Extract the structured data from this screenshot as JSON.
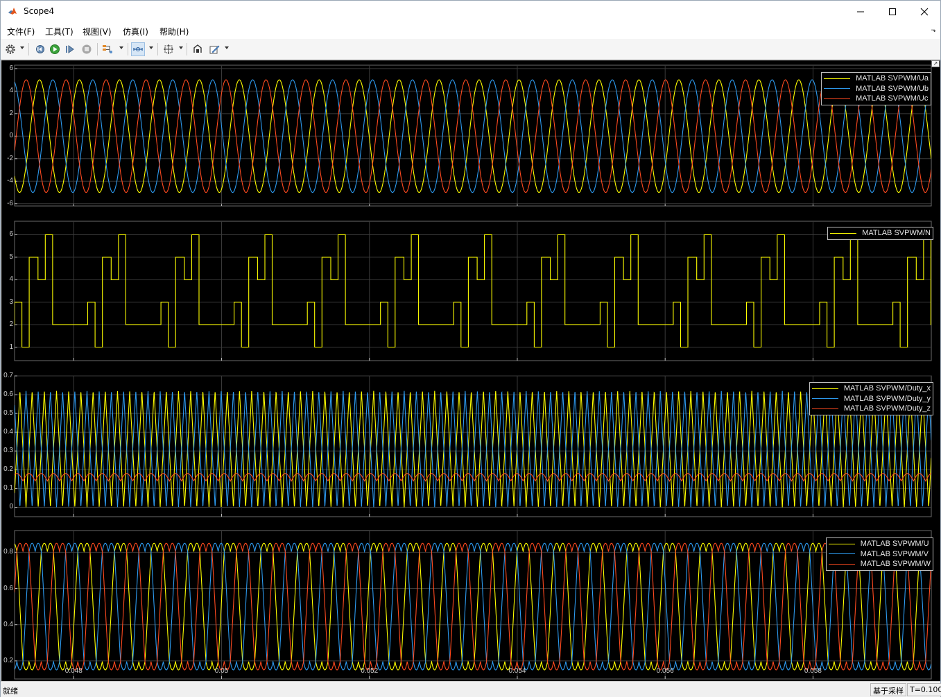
{
  "window": {
    "title": "Scope4",
    "icons": {
      "app": "matlab-logo-icon",
      "minimize": "minimize-icon",
      "maximize": "maximize-icon",
      "close": "close-icon"
    }
  },
  "menu": {
    "items": [
      "文件(F)",
      "工具(T)",
      "视图(V)",
      "仿真(I)",
      "帮助(H)"
    ]
  },
  "toolbar": {
    "buttons": [
      "settings-gear-icon",
      "step-back-icon",
      "run-icon",
      "step-forward-icon",
      "stop-icon",
      "signal-selector-icon",
      "zoom-axes-icon",
      "autoscale-icon",
      "write-data-icon",
      "highlight-block-icon"
    ]
  },
  "colors": {
    "yellow": "#ffff00",
    "blue": "#2d9bf0",
    "red": "#ff4a1f",
    "grid": "#3a3a3a",
    "background": "#000000"
  },
  "status": {
    "left": "就绪",
    "mode": "基于采样",
    "time": "T=0.100"
  },
  "chart_data": [
    {
      "type": "line",
      "title": "",
      "xlim": [
        0.0472,
        0.0596
      ],
      "ylim": [
        -6.2,
        6.3
      ],
      "yticks": [
        "-6",
        "-4",
        "-2",
        "0",
        "2",
        "4",
        "6"
      ],
      "ytick_values": [
        -6,
        -4,
        -2,
        0,
        2,
        4,
        6
      ],
      "grid": true,
      "legend_placement": "top-right",
      "series": [
        {
          "name": "MATLAB SVPWM/Ua",
          "color": "#ffff00",
          "waveform": "sine",
          "amplitude": 5,
          "frequency_hz": 1850,
          "phase_deg": 110
        },
        {
          "name": "MATLAB SVPWM/Ub",
          "color": "#2d9bf0",
          "waveform": "sine",
          "amplitude": 5,
          "frequency_hz": 1850,
          "phase_deg": -10
        },
        {
          "name": "MATLAB SVPWM/Uc",
          "color": "#ff4a1f",
          "waveform": "sine",
          "amplitude": 5,
          "frequency_hz": 1850,
          "phase_deg": 230
        }
      ]
    },
    {
      "type": "line",
      "title": "",
      "xlim": [
        0.0472,
        0.0596
      ],
      "ylim": [
        0.4,
        6.6
      ],
      "yticks": [
        "1",
        "2",
        "3",
        "4",
        "5",
        "6"
      ],
      "ytick_values": [
        1,
        2,
        3,
        4,
        5,
        6
      ],
      "grid": true,
      "legend_placement": "top-right",
      "series": [
        {
          "name": "MATLAB SVPWM/N",
          "color": "#ffff00",
          "waveform": "stairs",
          "sequence": [
            3,
            1,
            5,
            4,
            6,
            2
          ],
          "dwell_fraction": [
            0.1,
            0.1,
            0.12,
            0.1,
            0.1,
            0.48
          ],
          "period_s": 0.00099
        }
      ]
    },
    {
      "type": "line",
      "title": "",
      "xlim": [
        0.0472,
        0.0596
      ],
      "ylim": [
        -0.05,
        0.7
      ],
      "yticks": [
        "0",
        "0.1",
        "0.2",
        "0.3",
        "0.4",
        "0.5",
        "0.6",
        "0.7"
      ],
      "ytick_values": [
        0,
        0.1,
        0.2,
        0.3,
        0.4,
        0.5,
        0.6,
        0.7
      ],
      "grid": true,
      "legend_placement": "top-right",
      "series": [
        {
          "name": "MATLAB SVPWM/Duty_x",
          "color": "#ffff00",
          "waveform": "triangle",
          "min": 0.0,
          "max": 0.62,
          "period_s": 0.000165,
          "phase": 0.0
        },
        {
          "name": "MATLAB SVPWM/Duty_y",
          "color": "#2d9bf0",
          "waveform": "triangle",
          "min": 0.0,
          "max": 0.62,
          "period_s": 0.000165,
          "phase": 0.5
        },
        {
          "name": "MATLAB SVPWM/Duty_z",
          "color": "#ff4a1f",
          "waveform": "ripple",
          "min": 0.14,
          "max": 0.18,
          "period_s": 0.000165,
          "phase": 0.25
        }
      ]
    },
    {
      "type": "line",
      "title": "",
      "xlim": [
        0.0472,
        0.0596
      ],
      "ylim": [
        0.1,
        0.92
      ],
      "yticks": [
        "0.2",
        "0.4",
        "0.6",
        "0.8"
      ],
      "ytick_values": [
        0.2,
        0.4,
        0.6,
        0.8
      ],
      "grid": true,
      "legend_placement": "top-right",
      "series": [
        {
          "name": "MATLAB SVPWM/U",
          "color": "#ffff00",
          "waveform": "svpwm",
          "min": 0.15,
          "max": 0.85,
          "period_s": 0.000495,
          "phase": 0.0
        },
        {
          "name": "MATLAB SVPWM/V",
          "color": "#2d9bf0",
          "waveform": "svpwm",
          "min": 0.15,
          "max": 0.85,
          "period_s": 0.000495,
          "phase": 0.333
        },
        {
          "name": "MATLAB SVPWM/W",
          "color": "#ff4a1f",
          "waveform": "svpwm",
          "min": 0.15,
          "max": 0.85,
          "period_s": 0.000495,
          "phase": 0.667
        }
      ]
    }
  ],
  "xaxis": {
    "ticks": [
      "0.048",
      "0.05",
      "0.052",
      "0.054",
      "0.056",
      "0.058"
    ],
    "tick_values": [
      0.048,
      0.05,
      0.052,
      0.054,
      0.056,
      0.058
    ]
  }
}
